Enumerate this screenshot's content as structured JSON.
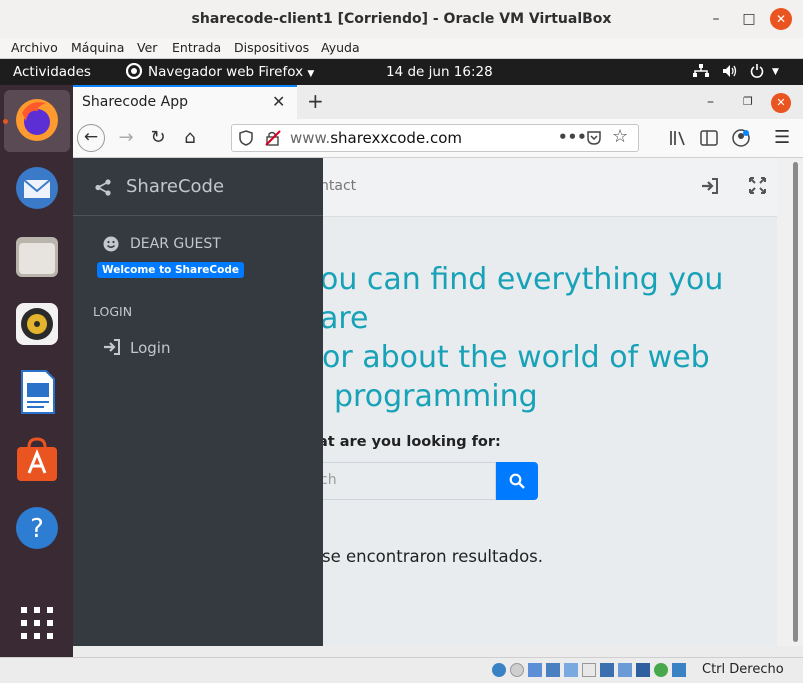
{
  "window": {
    "title": "sharecode-client1 [Corriendo] - Oracle VM VirtualBox"
  },
  "vbox_menu": [
    "Archivo",
    "Máquina",
    "Ver",
    "Entrada",
    "Dispositivos",
    "Ayuda"
  ],
  "topbar": {
    "activities": "Actividades",
    "app": "Navegador web Firefox",
    "datetime": "14 de jun  16:28"
  },
  "dock": [
    {
      "name": "firefox-icon",
      "color": "#ff7139"
    },
    {
      "name": "thunderbird-icon",
      "color": "#3b7ac9"
    },
    {
      "name": "files-icon",
      "color": "#d9d6d0"
    },
    {
      "name": "rhythmbox-icon",
      "color": "#e3b42c"
    },
    {
      "name": "writer-icon",
      "color": "#2a72c9"
    },
    {
      "name": "software-icon",
      "color": "#e95420"
    },
    {
      "name": "help-icon",
      "color": "#2d7dd2"
    }
  ],
  "browser": {
    "tab_title": "Sharecode App",
    "url_plain": "www.",
    "url_domain": "sharexxcode.com"
  },
  "page": {
    "nav_fragment": "ntact",
    "hero_line1": "ou can find everything you are",
    "hero_line2": "or about the world of web",
    "hero_line3": "programming",
    "search_label": "at are you looking for:",
    "search_placeholder": "ch",
    "no_results": "se encontraron resultados."
  },
  "sidebar": {
    "brand": "ShareCode",
    "user": "DEAR GUEST",
    "badge": "Welcome to ShareCode",
    "section": "LOGIN",
    "login": "Login"
  },
  "statusbar": {
    "host_key": "Ctrl Derecho"
  },
  "colors": {
    "accent": "#17a2b8",
    "primary": "#007bff",
    "sidebar": "#343a40",
    "ubuntu_orange": "#e95420"
  }
}
